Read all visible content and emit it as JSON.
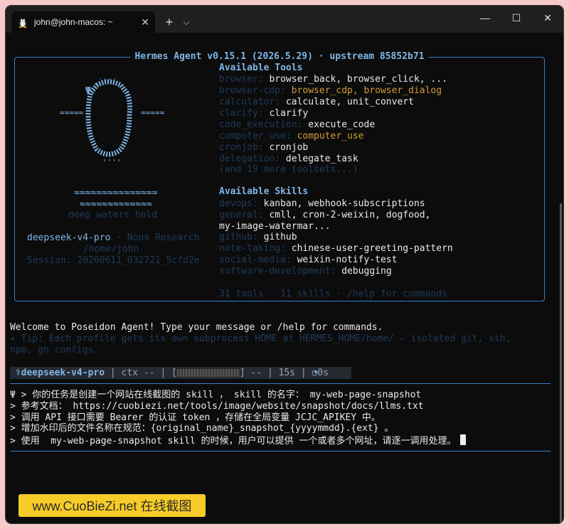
{
  "window": {
    "tab_title": "john@john-macos: ~",
    "tab_close": "✕",
    "new_tab": "+",
    "dropdown": "⌵",
    "minimize": "—",
    "maximize": "☐",
    "close": "✕"
  },
  "banner": {
    "title": "Hermes Agent v0.15.1 (2026.5.29) · upstream 85852b71",
    "art_tagline": "deep waters hold",
    "model": "deepseek-v4-pro",
    "provider": " · Nous Research",
    "home": "/home/john",
    "session": "Session: 20260611_032721_5cfd2e",
    "tools_header": "Available Tools",
    "tools": [
      {
        "key": "browser:",
        "val": "browser_back, browser_click, ...",
        "color": "val"
      },
      {
        "key": "browser-cdp:",
        "val": "browser_cdp, browser_dialog",
        "color": "amber"
      },
      {
        "key": "calculator:",
        "val": "calculate, unit_convert",
        "color": "val"
      },
      {
        "key": "clarify:",
        "val": "clarify",
        "color": "val"
      },
      {
        "key": "code_execution:",
        "val": "execute_code",
        "color": "val"
      },
      {
        "key": "computer_use:",
        "val": "computer_use",
        "color": "amber"
      },
      {
        "key": "cronjob:",
        "val": "cronjob",
        "color": "val"
      },
      {
        "key": "delegation:",
        "val": "delegate_task",
        "color": "val"
      }
    ],
    "tools_more": "(and 19 more toolsets...)",
    "skills_header": "Available Skills",
    "skills": [
      {
        "key": "devops:",
        "val": "kanban, webhook-subscriptions"
      },
      {
        "key": "general:",
        "val": "cmll, cron-2-weixin, dogfood,"
      },
      {
        "key": "",
        "val": "my-image-watermar..."
      },
      {
        "key": "github:",
        "val": "github"
      },
      {
        "key": "note-taking:",
        "val": "chinese-user-greeting-pattern"
      },
      {
        "key": "social-media:",
        "val": "weixin-notify-test"
      },
      {
        "key": "software-development:",
        "val": "debugging"
      }
    ],
    "summary": "31 tools · 11 skills · /help for commands"
  },
  "welcome": "Welcome to Poseidon Agent! Type your message or /help for commands.",
  "tip_line1": "✦ Tip: Each profile gets its own subprocess HOME at HERMES_HOME/home/ — isolated git, ssh,",
  "tip_line2": "npm, gh configs.",
  "status": {
    "model": "deepseek-v4-pro",
    "ctx": " | ctx -- | [",
    "ctx_end": "] -- | 15s | ",
    "timer": "0s"
  },
  "input_lines": [
    "Ψ > 你的任务是创建一个网站在线截图的 skill ， skill 的名字： my-web-page-snapshot",
    "> 参考文档： https://cuobiezi.net/tools/image/website/snapshot/docs/llms.txt",
    "> 调用 API 接口需要 Bearer 的认证 token ，存储在全局变量 JCJC_APIKEY 中。",
    "> 增加水印后的文件名称在规范：{original_name}_snapshot_{yyyymmdd}.{ext} 。",
    "> 使用  my-web-page-snapshot skill 的时候，用户可以提供 一个或者多个网址，请逐一调用处理。"
  ],
  "watermark": "www.CuoBieZi.net 在线截图",
  "colors": {
    "accent": "#3b7fc4",
    "header": "#7fb6e8",
    "dim_key": "#1f3a5a",
    "amber": "#d29b3a",
    "watermark_bg": "#f8cc28"
  }
}
